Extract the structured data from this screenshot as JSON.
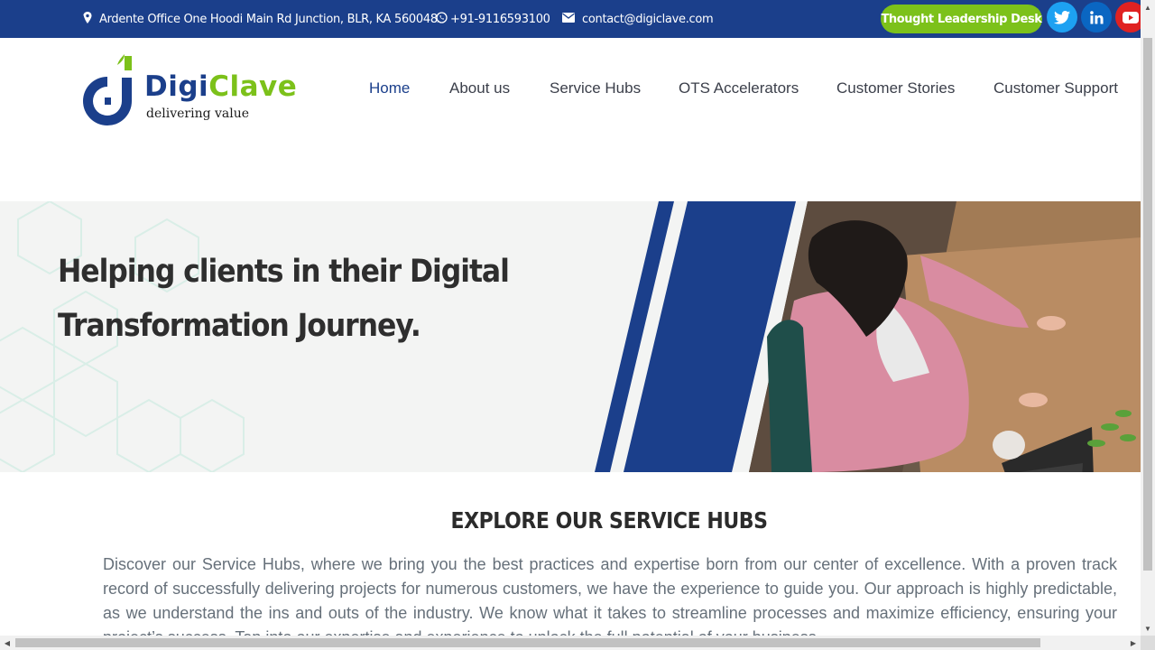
{
  "topbar": {
    "address": "Ardente Office One Hoodi Main Rd Junction, BLR, KA 560048",
    "phone": "+91-9116593100",
    "email": "contact@digiclave.com",
    "thought_leadership_label": "Thought Leadership Desk",
    "address_icon": "map-pin-icon",
    "phone_icon": "whatsapp-icon",
    "email_icon": "envelope-icon",
    "social_icons": [
      "twitter-icon",
      "linkedin-icon",
      "youtube-icon"
    ],
    "colors": {
      "bar": "#1b3f8b",
      "button": "#7cc11a",
      "twitter": "#1da1f2",
      "linkedin": "#0a66c2",
      "youtube": "#e02222"
    }
  },
  "brand": {
    "name_part1": "Digi",
    "name_part2": "Clave",
    "tagline": "delivering value",
    "colors": {
      "primary": "#1b3f8b",
      "accent": "#7cc11a"
    }
  },
  "nav": {
    "items": [
      "Home",
      "About us",
      "Service Hubs",
      "OTS Accelerators",
      "Customer Stories",
      "Customer Support"
    ],
    "active": "Home"
  },
  "hero": {
    "title": "Helping clients in their Digital Transformation Journey."
  },
  "service_hubs": {
    "title": "EXPLORE OUR SERVICE HUBS",
    "description": "Discover our Service Hubs, where we bring you the best practices and expertise born from our center of excellence. With a proven track record of successfully delivering projects for numerous customers, we have the experience to guide you. Our approach is highly predictable, as we understand the ins and outs of the industry. We know what it takes to streamline processes and maximize efficiency, ensuring your project’s success. Tap into our expertise and experience to unlock the full potential of your business."
  }
}
